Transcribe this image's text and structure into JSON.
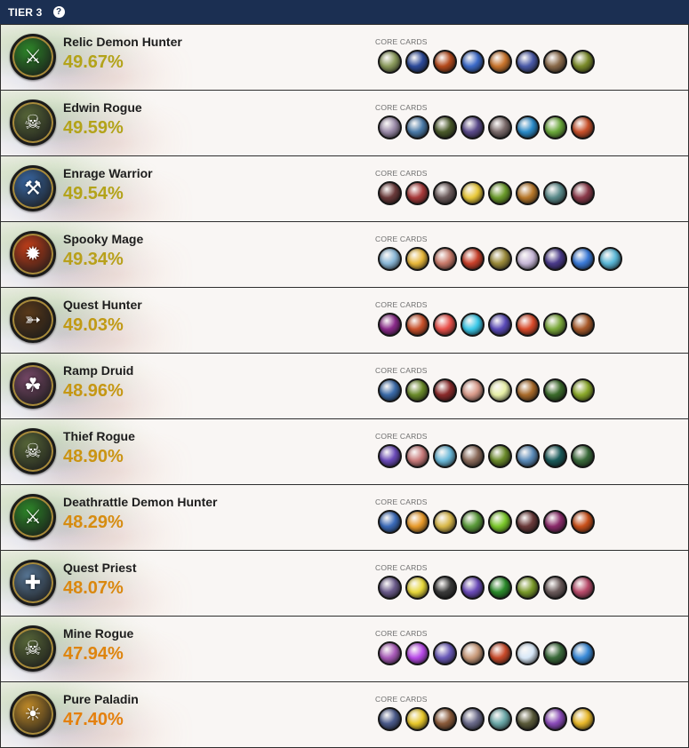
{
  "header": {
    "title": "TIER 3",
    "help_glyph": "?"
  },
  "core_cards_label": "CORE CARDS",
  "decks": [
    {
      "name": "Relic Demon Hunter",
      "winrate": "49.67%",
      "icon": "demon-hunter-icon",
      "icon_color": "#2f8a2a",
      "rate_color": "#b3a319",
      "cards": [
        "#8a9a5c",
        "#2c4a9a",
        "#b44a1c",
        "#3c6ac8",
        "#c8742c",
        "#4a5aa8",
        "#8a6a4a",
        "#7a8a2a"
      ]
    },
    {
      "name": "Edwin Rogue",
      "winrate": "49.59%",
      "icon": "rogue-icon",
      "icon_color": "#5a6a3a",
      "rate_color": "#b3a319",
      "cards": [
        "#9a8aa8",
        "#4a7aa8",
        "#4a5a2a",
        "#5a4a8a",
        "#7a6a6a",
        "#2a8ac8",
        "#6aa83a",
        "#c8502a"
      ]
    },
    {
      "name": "Enrage Warrior",
      "winrate": "49.54%",
      "icon": "warrior-icon",
      "icon_color": "#3a6aa8",
      "rate_color": "#b3a319",
      "cards": [
        "#6a3a3a",
        "#a83a3a",
        "#6a5a5a",
        "#e8c83a",
        "#6a9a2a",
        "#b8782a",
        "#5a8a8a",
        "#8a3a4a"
      ]
    },
    {
      "name": "Spooky Mage",
      "winrate": "49.34%",
      "icon": "mage-icon",
      "icon_color": "#c8401a",
      "rate_color": "#b8a01a",
      "cards": [
        "#8ab8d8",
        "#e8b83a",
        "#c87a6a",
        "#c8402a",
        "#9a8a3a",
        "#c8b8d8",
        "#4a3a8a",
        "#3a7ad8",
        "#5ab8d8"
      ]
    },
    {
      "name": "Quest Hunter",
      "winrate": "49.03%",
      "icon": "hunter-icon",
      "icon_color": "#5a3a1a",
      "rate_color": "#c09a15",
      "cards": [
        "#8a2a8a",
        "#c8502a",
        "#e8504a",
        "#3ac8e8",
        "#5a4ab8",
        "#d84a2a",
        "#7aa83a",
        "#a85a2a"
      ]
    },
    {
      "name": "Ramp Druid",
      "winrate": "48.96%",
      "icon": "druid-icon",
      "icon_color": "#7a4a6a",
      "rate_color": "#c59713",
      "cards": [
        "#3a6aa8",
        "#6a8a2a",
        "#8a2a2a",
        "#d89a8a",
        "#e8f0a8",
        "#a86a2a",
        "#3a6a2a",
        "#8aa82a"
      ]
    },
    {
      "name": "Thief Rogue",
      "winrate": "48.90%",
      "icon": "rogue-icon",
      "icon_color": "#5a6a3a",
      "rate_color": "#ca9412",
      "cards": [
        "#6a4ab8",
        "#c87a7a",
        "#6ab8d8",
        "#8a6a5a",
        "#6a8a2a",
        "#5a8ab8",
        "#1a5a5a",
        "#3a6a3a"
      ]
    },
    {
      "name": "Deathrattle Demon Hunter",
      "winrate": "48.29%",
      "icon": "demon-hunter-icon",
      "icon_color": "#2f8a2a",
      "rate_color": "#d68c10",
      "cards": [
        "#3a6ab8",
        "#e89a2a",
        "#d8b84a",
        "#5a9a3a",
        "#7ac82a",
        "#6a3a3a",
        "#8a2a6a",
        "#c8501a"
      ]
    },
    {
      "name": "Quest Priest",
      "winrate": "48.07%",
      "icon": "priest-icon",
      "icon_color": "#5a7a9a",
      "rate_color": "#da880f",
      "cards": [
        "#6a5a8a",
        "#e8d83a",
        "#3a3a3a",
        "#6a4ab8",
        "#2a8a2a",
        "#7a9a2a",
        "#6a5a5a",
        "#b84a6a"
      ]
    },
    {
      "name": "Mine Rogue",
      "winrate": "47.94%",
      "icon": "rogue-icon",
      "icon_color": "#5a6a3a",
      "rate_color": "#de850e",
      "cards": [
        "#a85ab8",
        "#b84ae8",
        "#6a5ab8",
        "#c89a7a",
        "#c84a2a",
        "#d8e8f8",
        "#3a6a3a",
        "#3a8ad8"
      ]
    },
    {
      "name": "Pure Paladin",
      "winrate": "47.40%",
      "icon": "paladin-icon",
      "icon_color": "#c8902a",
      "rate_color": "#e4800d",
      "cards": [
        "#4a5a8a",
        "#e8c82a",
        "#8a5a3a",
        "#6a6a8a",
        "#6aa8a8",
        "#5a5a3a",
        "#8a4ab8",
        "#e8b82a"
      ]
    }
  ]
}
